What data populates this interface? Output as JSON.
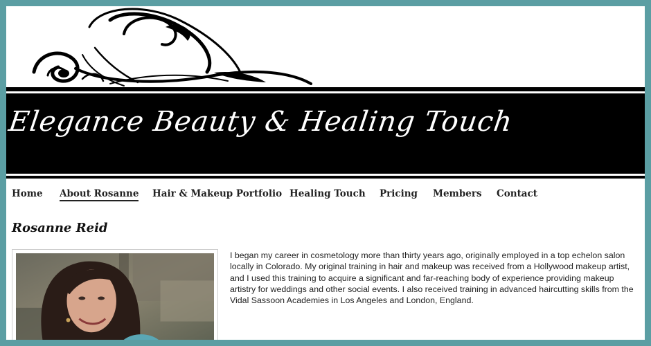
{
  "header": {
    "site_title": "Elegance Beauty & Healing Touch"
  },
  "nav": {
    "items": [
      {
        "label": "Home"
      },
      {
        "label": "About Rosanne"
      },
      {
        "label": "Hair & Makeup Portfolio"
      },
      {
        "label": "Healing Touch"
      },
      {
        "label": "Pricing"
      },
      {
        "label": "Members"
      },
      {
        "label": "Contact"
      }
    ],
    "active": "About Rosanne"
  },
  "main": {
    "heading": "Rosanne Reid",
    "bio": "I began my career in cosmetology more than thirty years ago, originally employed in a top echelon salon locally in Colorado. My original training in hair and makeup was received from a Hollywood makeup artist, and I used this training to acquire a significant and far-reaching body of experience providing makeup artistry for weddings and other social events. I also received training in advanced haircutting skills from the Vidal Sassoon Academies in Los Angeles and London, England."
  },
  "colors": {
    "page_border": "#5b9ea3",
    "banner": "#000000",
    "banner_text": "#ffffff",
    "text": "#222222"
  }
}
